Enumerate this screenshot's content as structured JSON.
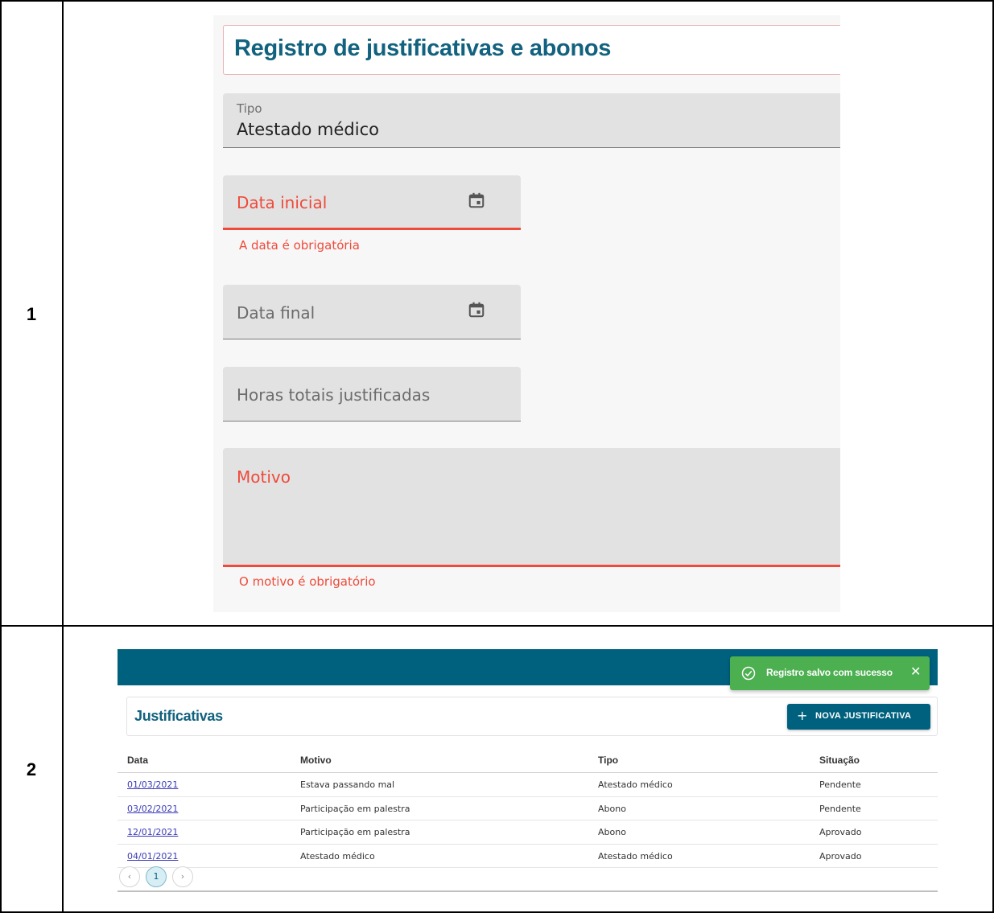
{
  "rows": {
    "first": {
      "number": "1"
    },
    "second": {
      "number": "2"
    }
  },
  "form": {
    "title": "Registro de justificativas e abonos",
    "tipo": {
      "label": "Tipo",
      "value": "Atestado médico"
    },
    "data_inicial": {
      "label": "Data inicial",
      "error": "A data é obrigatória",
      "icon": "calendar-icon"
    },
    "data_final": {
      "label": "Data final",
      "icon": "calendar-icon"
    },
    "horas": {
      "label": "Horas totais justificadas"
    },
    "motivo": {
      "label": "Motivo",
      "error": "O motivo é obrigatório"
    },
    "colors": {
      "title": "#12627f",
      "error": "#ef4a3a",
      "field_bg": "#e2e2e2"
    }
  },
  "list": {
    "title": "Justificativas",
    "new_button": {
      "icon": "plus-icon",
      "label": "NOVA JUSTIFICATIVA"
    },
    "toast": {
      "icon": "check-circle-icon",
      "message": "Registro salvo com sucesso",
      "close": "✕"
    },
    "columns": [
      "Data",
      "Motivo",
      "Tipo",
      "Situação"
    ],
    "records": [
      {
        "data": "01/03/2021",
        "motivo": "Estava passando mal",
        "tipo": "Atestado médico",
        "situacao": "Pendente"
      },
      {
        "data": "03/02/2021",
        "motivo": "Participação em palestra",
        "tipo": "Abono",
        "situacao": "Pendente"
      },
      {
        "data": "12/01/2021",
        "motivo": "Participação em palestra",
        "tipo": "Abono",
        "situacao": "Aprovado"
      },
      {
        "data": "04/01/2021",
        "motivo": "Atestado médico",
        "tipo": "Atestado médico",
        "situacao": "Aprovado"
      }
    ],
    "pagination": {
      "prev": "‹",
      "current": "1",
      "next": "›"
    },
    "colors": {
      "header_bar": "#00617f",
      "toast": "#4caf50",
      "link": "#3a3ab8"
    }
  }
}
